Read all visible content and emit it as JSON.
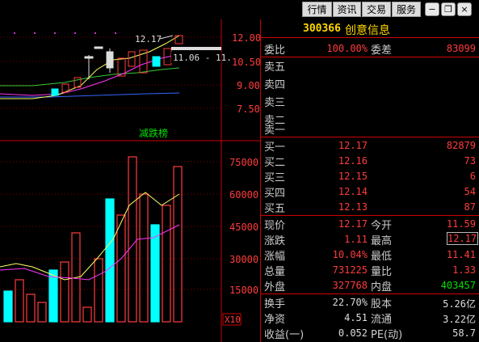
{
  "toolbar": {
    "buttons": [
      "行情",
      "资讯",
      "交易",
      "服务"
    ],
    "window_controls": [
      "minimize",
      "restore",
      "close"
    ]
  },
  "chart": {
    "price_labels": [
      "12.00",
      "10.50",
      "9.00",
      "7.50"
    ],
    "annotation_price": "12.17",
    "annotation_date": "11.06 - 11.",
    "badge": "减跌榜",
    "volume_labels": [
      "75000",
      "60000",
      "45000",
      "30000",
      "15000"
    ],
    "volume_unit": "X10"
  },
  "quote": {
    "code": "300366",
    "name": "创意信息",
    "weibi_label": "委比",
    "weibi": "100.00%",
    "weicha_label": "委差",
    "weicha": "83099",
    "asks": [
      {
        "label": "卖五",
        "price": "",
        "vol": ""
      },
      {
        "label": "卖四",
        "price": "",
        "vol": ""
      },
      {
        "label": "卖三",
        "price": "",
        "vol": ""
      },
      {
        "label": "卖二",
        "price": "",
        "vol": ""
      },
      {
        "label": "卖一",
        "price": "",
        "vol": ""
      }
    ],
    "bids": [
      {
        "label": "买一",
        "price": "12.17",
        "vol": "82879"
      },
      {
        "label": "买二",
        "price": "12.16",
        "vol": "73"
      },
      {
        "label": "买三",
        "price": "12.15",
        "vol": "6"
      },
      {
        "label": "买四",
        "price": "12.14",
        "vol": "54"
      },
      {
        "label": "买五",
        "price": "12.13",
        "vol": "87"
      }
    ],
    "stats": {
      "xianjia_label": "现价",
      "xianjia": "12.17",
      "jinkai_label": "今开",
      "jinkai": "11.59",
      "zhangdie_label": "涨跌",
      "zhangdie": "1.11",
      "zuigao_label": "最高",
      "zuigao": "12.17",
      "zhangfu_label": "涨幅",
      "zhangfu": "10.04%",
      "zuidi_label": "最低",
      "zuidi": "11.41",
      "zongliang_label": "总量",
      "zongliang": "731225",
      "liangbi_label": "量比",
      "liangbi": "1.33",
      "waipan_label": "外盘",
      "waipan": "327768",
      "neipan_label": "内盘",
      "neipan": "403457",
      "huanshou_label": "换手",
      "huanshou": "22.70%",
      "guben_label": "股本",
      "guben": "5.26亿",
      "jingzi_label": "净资",
      "jingzi": "4.51",
      "liutong_label": "流通",
      "liutong": "3.22亿",
      "shouyi_label": "收益(一)",
      "shouyi": "0.052",
      "pe_label": "PE(动)",
      "pe": "58.7"
    }
  },
  "colors": {
    "up": "#ff3c3c",
    "down": "#00ffff",
    "grid": "#8b0000",
    "ma_yellow": "#ffff66",
    "ma_magenta": "#ff33ff",
    "ma_green": "#33cc33",
    "ma_blue": "#3366ff"
  }
}
